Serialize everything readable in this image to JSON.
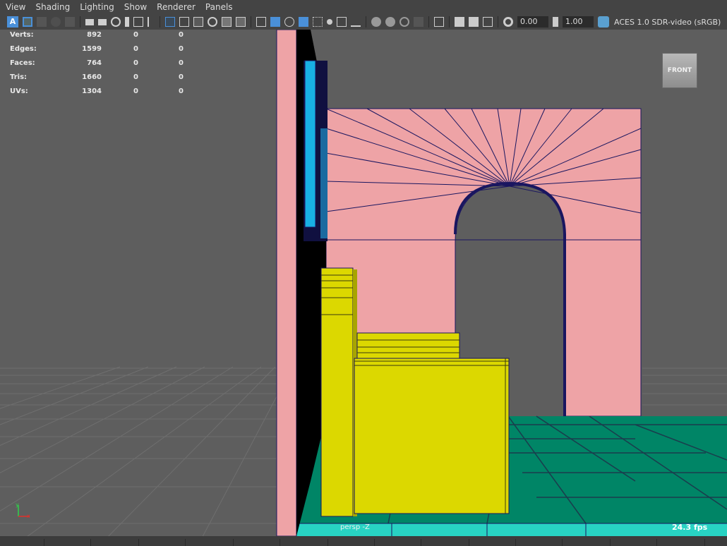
{
  "menu": [
    "View",
    "Shading",
    "Lighting",
    "Show",
    "Renderer",
    "Panels"
  ],
  "toolbar": {
    "exposure_value": "0.00",
    "gamma_value": "1.00",
    "color_space": "ACES 1.0 SDR-video (sRGB)",
    "icons": [
      "select-camera-icon",
      "camera-attributes-icon",
      "bookmark-icon",
      "image-plane-icon",
      "grid-icon",
      "film-gate-icon",
      "resolution-gate-icon",
      "gate-mask-icon",
      "field-chart-icon",
      "safe-action-icon",
      "safe-title-icon",
      "wireframe-icon",
      "smooth-shade-icon",
      "default-material-icon",
      "wireframe-on-shaded-icon",
      "textured-icon",
      "use-all-lights-icon",
      "shadows-icon",
      "screen-space-ao-icon",
      "motion-blur-icon",
      "anti-aliasing-icon",
      "depth-of-field-icon",
      "isolate-select-icon",
      "xray-icon",
      "xray-joints-icon",
      "xray-active-icon",
      "exposure-icon",
      "gamma-icon",
      "color-management-icon"
    ]
  },
  "stats": [
    {
      "label": "Verts:",
      "v1": "892",
      "v2": "0",
      "v3": "0"
    },
    {
      "label": "Edges:",
      "v1": "1599",
      "v2": "0",
      "v3": "0"
    },
    {
      "label": "Faces:",
      "v1": "764",
      "v2": "0",
      "v3": "0"
    },
    {
      "label": "Tris:",
      "v1": "1660",
      "v2": "0",
      "v3": "0"
    },
    {
      "label": "UVs:",
      "v1": "1304",
      "v2": "0",
      "v3": "0"
    }
  ],
  "viewcube_label": "FRONT",
  "camera_label": "persp -Z",
  "fps": "24.3 fps",
  "colors": {
    "wall_pink": "#eea3a6",
    "tile_green": "#008566",
    "tile_cyan": "#28d3c3",
    "chair_yellow": "#dcd800",
    "mirror_blue": "#18b0e4",
    "edge_navy": "#1a1660"
  }
}
